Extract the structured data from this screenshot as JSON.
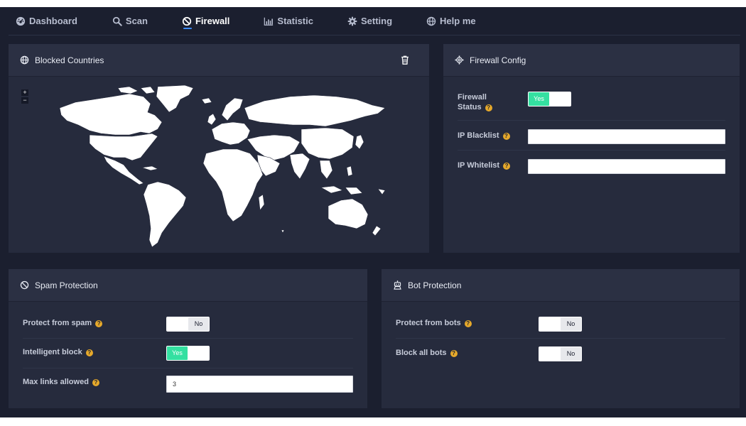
{
  "nav": {
    "items": [
      {
        "label": "Dashboard",
        "icon": "dashboard-icon"
      },
      {
        "label": "Scan",
        "icon": "search-icon"
      },
      {
        "label": "Firewall",
        "icon": "ban-icon",
        "active": true
      },
      {
        "label": "Statistic",
        "icon": "bar-chart-icon"
      },
      {
        "label": "Setting",
        "icon": "gear-icon"
      },
      {
        "label": "Help me",
        "icon": "globe-icon"
      }
    ]
  },
  "countries": {
    "title": "Blocked Countries",
    "icon": "globe-icon",
    "action_icon": "trash-icon",
    "zoom_in": "+",
    "zoom_out": "−"
  },
  "firewall": {
    "title": "Firewall Config",
    "icon": "gear-icon",
    "status_label_1": "Firewall",
    "status_label_2": "Status",
    "status_value": "Yes",
    "blacklist_label": "IP Blacklist",
    "blacklist_value": "",
    "whitelist_label": "IP Whitelist",
    "whitelist_value": ""
  },
  "spam": {
    "title": "Spam Protection",
    "icon": "ban-icon",
    "protect_label": "Protect from spam",
    "protect_value": "No",
    "intelligent_label": "Intelligent block",
    "intelligent_value": "Yes",
    "maxlinks_label": "Max links allowed",
    "maxlinks_value": "3"
  },
  "bot": {
    "title": "Bot Protection",
    "icon": "robot-icon",
    "protect_label": "Protect from bots",
    "protect_value": "No",
    "blockall_label": "Block all bots",
    "blockall_value": "No"
  },
  "help_glyph": "?",
  "colors": {
    "background": "#1b1f2f",
    "panel": "#262b3d",
    "accent": "#3d8bff",
    "toggle_on": "#34e0a1",
    "help": "#e6a92b"
  }
}
